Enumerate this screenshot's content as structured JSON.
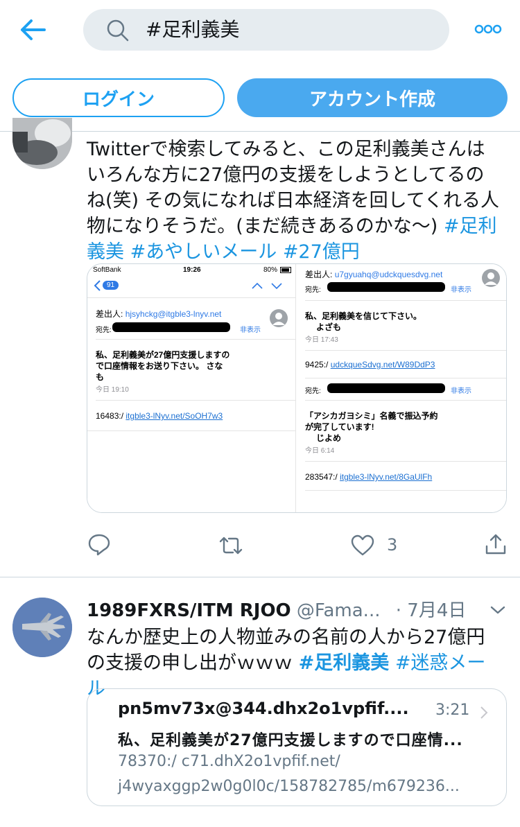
{
  "header": {
    "search_query": "#足利義美",
    "login_label": "ログイン",
    "signup_label": "アカウント作成"
  },
  "tweet1": {
    "text": "Twitterで検索してみると、この足利義美さんはいろんな方に27億円の支援をしようとしてるのね(笑) その気になれば日本経済を回してくれる人物になりそうだ。(まだ続きあるのかな〜) ",
    "hashtags": [
      "#足利義美",
      "#あやしいメール",
      "#27億円"
    ],
    "like_count": "3",
    "media": {
      "left": {
        "carrier": "SoftBank",
        "clock": "19:26",
        "battery": "80%",
        "badge": "91",
        "from_label": "差出人:",
        "from": "hjsyhckg@itgble3-lnyv.net",
        "to_label": "宛先:",
        "hide": "非表示",
        "body_l1": "私、足利義美が27億円支援しますの",
        "body_l2": "で口座情報をお送り下さい。 さな",
        "body_l3": "も",
        "time": "今日 19:10",
        "link_prefix": "16483:/",
        "link": "itgble3-lNyv.net/SoOH7w3"
      },
      "right": {
        "from_label": "差出人:",
        "from": "u7gyuahq@udckquesdvg.net",
        "to_label": "宛先:",
        "hide": "非表示",
        "body1_l1": "私、足利義美を信じて下さい。",
        "body1_l2": "よざも",
        "time1": "今日 17:43",
        "link1_prefix": "9425:/",
        "link1": "udckqueSdvg.net/W89DdP3",
        "to_label2": "宛先:",
        "hide2": "非表示",
        "body2_l1": "「アシカガヨシミ」名義で振込予約",
        "body2_l2": "が完了しています!",
        "body2_l3": "じよめ",
        "time2": "今日 6:14",
        "link2_prefix": "283547:/",
        "link2": "itgble3-lNyv.net/8GaUlFh"
      }
    }
  },
  "tweet2": {
    "name": "1989FXRS/ITM RJOO",
    "handle": "@Fama...",
    "date": "· 7月4日",
    "text": "なんか歴史上の人物並みの名前の人から27億円の支援の申し出がｗｗｗ ",
    "hashtags": [
      "#足利義美",
      "#迷惑メール"
    ],
    "quote": {
      "sender": "pn5mv73x@344.dhx2o1vpfif....",
      "time": "3:21",
      "subject": "私、足利義美が27億円支援しますので口座情...",
      "body_l1": "78370:/ c71.dhX2o1vpfif.net/",
      "body_l2": "j4wyaxggp2w0g0l0c/158782785/m679236..."
    }
  },
  "colors": {
    "accent": "#1da1f2",
    "signup_bg": "#4aa9ef",
    "gray_text": "#657786"
  }
}
